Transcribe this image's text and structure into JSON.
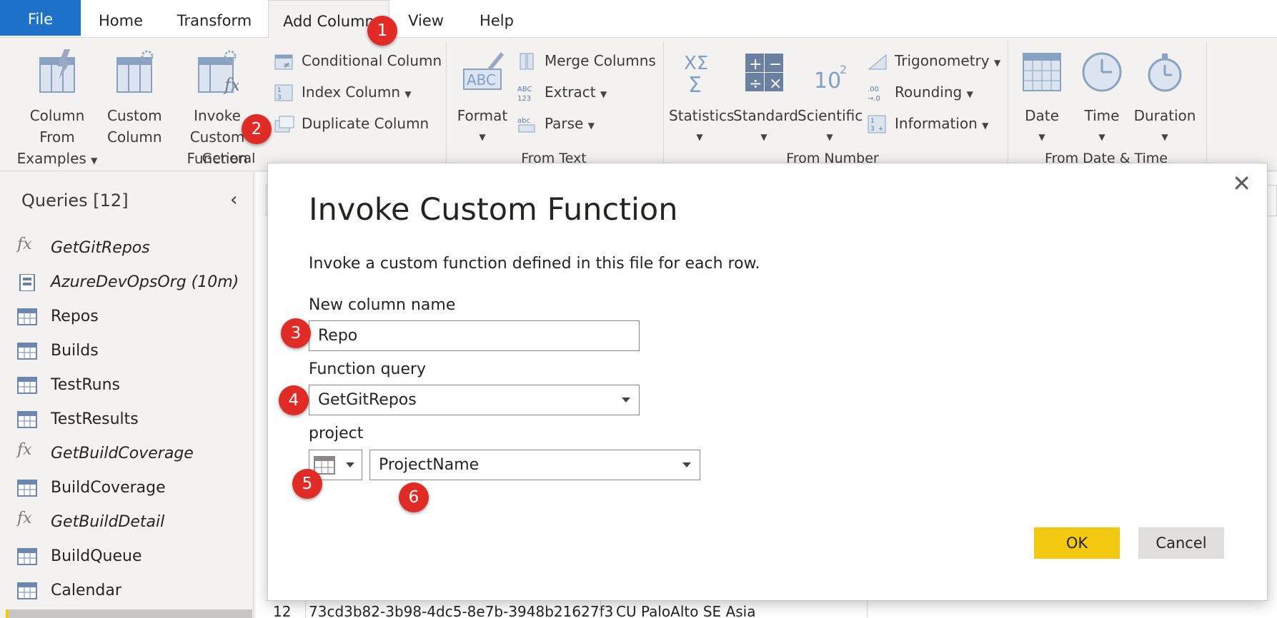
{
  "tabs": [
    {
      "label": "File"
    },
    {
      "label": "Home"
    },
    {
      "label": "Transform"
    },
    {
      "label": "Add Column"
    },
    {
      "label": "View"
    },
    {
      "label": "Help"
    }
  ],
  "ribbon": {
    "general": {
      "group_label": "General",
      "column_from_examples": [
        "Column From",
        "Examples"
      ],
      "custom_column": [
        "Custom",
        "Column"
      ],
      "invoke_custom_function": [
        "Invoke Custom",
        "Function"
      ],
      "conditional_column": "Conditional Column",
      "index_column": "Index Column",
      "duplicate_column": "Duplicate Column"
    },
    "from_text": {
      "group_label": "From Text",
      "format": "Format",
      "merge_columns": "Merge Columns",
      "extract": "Extract",
      "parse": "Parse"
    },
    "from_number": {
      "group_label": "From Number",
      "statistics": "Statistics",
      "standard": "Standard",
      "scientific": "Scientific",
      "trigonometry": "Trigonometry",
      "rounding": "Rounding",
      "information": "Information"
    },
    "from_date_time": {
      "group_label": "From Date & Time",
      "date": "Date",
      "time": "Time",
      "duration": "Duration"
    }
  },
  "sidebar": {
    "title": "Queries [12]",
    "items": [
      {
        "label": "GetGitRepos",
        "type": "function"
      },
      {
        "label": "AzureDevOpsOrg (10m)",
        "type": "parameter"
      },
      {
        "label": "Repos",
        "type": "table"
      },
      {
        "label": "Builds",
        "type": "table"
      },
      {
        "label": "TestRuns",
        "type": "table"
      },
      {
        "label": "TestResults",
        "type": "table"
      },
      {
        "label": "GetBuildCoverage",
        "type": "function"
      },
      {
        "label": "BuildCoverage",
        "type": "table"
      },
      {
        "label": "GetBuildDetail",
        "type": "function"
      },
      {
        "label": "BuildQueue",
        "type": "table"
      },
      {
        "label": "Calendar",
        "type": "table"
      }
    ]
  },
  "grid": {
    "row_number": "12",
    "cell_1": "73cd3b82-3b98-4dc5-8e7b-3948b21627f3",
    "cell_2": "CU PaloAlto SE Asia"
  },
  "dialog": {
    "title": "Invoke Custom Function",
    "description": "Invoke a custom function defined in this file for each row.",
    "new_column_label": "New column name",
    "new_column_value": "Repo",
    "function_query_label": "Function query",
    "function_query_value": "GetGitRepos",
    "param_label": "project",
    "param_value": "ProjectName",
    "ok": "OK",
    "cancel": "Cancel"
  },
  "badges": [
    "1",
    "2",
    "3",
    "4",
    "5",
    "6"
  ],
  "colors": {
    "file_tab": "#1b72c8",
    "ok_button": "#f2c811",
    "badge": "#e02b27",
    "icon_blue": "#7f9fc7"
  }
}
